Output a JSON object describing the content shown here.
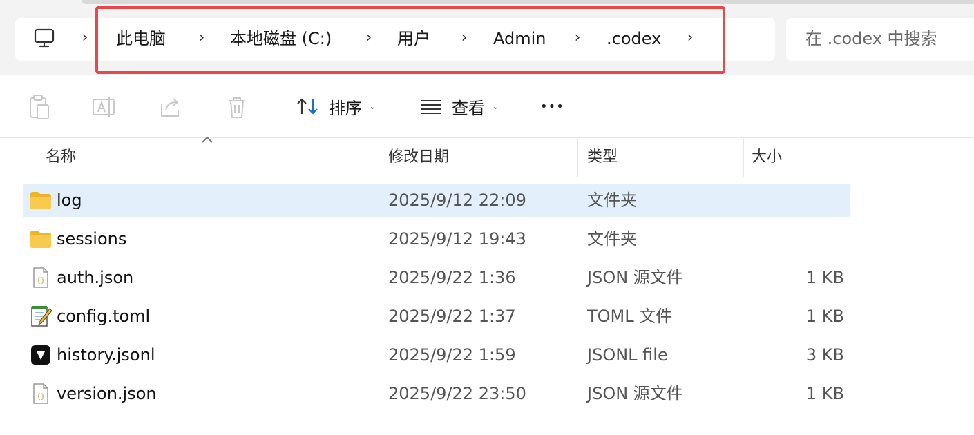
{
  "breadcrumb": [
    "此电脑",
    "本地磁盘 (C:)",
    "用户",
    "Admin",
    ".codex"
  ],
  "search": {
    "placeholder": "在 .codex 中搜索"
  },
  "toolbar": {
    "sort_label": "排序",
    "view_label": "查看",
    "more_label": "•••"
  },
  "columns": {
    "name": "名称",
    "modified": "修改日期",
    "type": "类型",
    "size": "大小"
  },
  "files": [
    {
      "name": "log",
      "modified": "2025/9/12 22:09",
      "type": "文件夹",
      "size": "",
      "icon": "folder-icon",
      "selected": true
    },
    {
      "name": "sessions",
      "modified": "2025/9/12 19:43",
      "type": "文件夹",
      "size": "",
      "icon": "folder-icon",
      "selected": false
    },
    {
      "name": "auth.json",
      "modified": "2025/9/22 1:36",
      "type": "JSON 源文件",
      "size": "1 KB",
      "icon": "json-file-icon",
      "selected": false
    },
    {
      "name": "config.toml",
      "modified": "2025/9/22 1:37",
      "type": "TOML 文件",
      "size": "1 KB",
      "icon": "notepad-file-icon",
      "selected": false
    },
    {
      "name": "history.jsonl",
      "modified": "2025/9/22 1:59",
      "type": "JSONL file",
      "size": "3 KB",
      "icon": "app-file-icon",
      "selected": false
    },
    {
      "name": "version.json",
      "modified": "2025/9/22 23:50",
      "type": "JSON 源文件",
      "size": "1 KB",
      "icon": "json-file-icon",
      "selected": false
    }
  ],
  "colors": {
    "highlight": "#e5484d",
    "selection": "#e3effb",
    "folder": "#f5c543"
  }
}
